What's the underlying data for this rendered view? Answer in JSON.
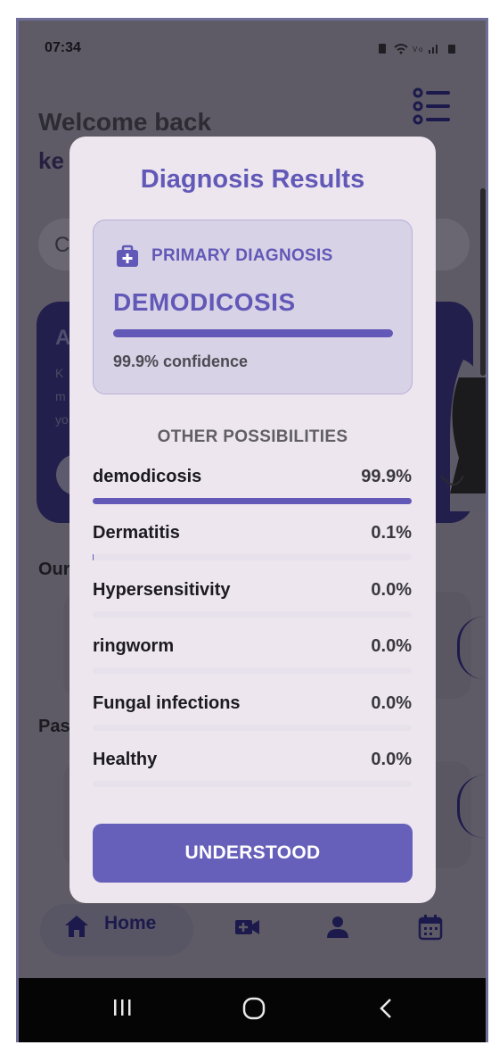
{
  "status_bar": {
    "time": "07:34",
    "icons": [
      "battery-saver-icon",
      "wifi-icon",
      "volte-icon",
      "signal-icon",
      "battery-icon"
    ]
  },
  "background": {
    "welcome_text": "Welcome back",
    "username_fragment": "ke",
    "search_fragment": "C",
    "banner_title_fragment": "A",
    "banner_text_fragment": "K\nm\nyo",
    "section_1_fragment": "Our",
    "section_2_fragment": "Pas",
    "nav_home_label": "Home"
  },
  "dialog": {
    "title": "Diagnosis Results",
    "primary": {
      "label": "PRIMARY DIAGNOSIS",
      "name": "DEMODICOSIS",
      "confidence_value": 99.9,
      "confidence_text": "99.9% confidence"
    },
    "other_heading": "OTHER POSSIBILITIES",
    "possibilities": [
      {
        "name": "demodicosis",
        "value_text": "99.9%",
        "value": 99.9
      },
      {
        "name": "Dermatitis",
        "value_text": "0.1%",
        "value": 0.1
      },
      {
        "name": "Hypersensitivity",
        "value_text": "0.0%",
        "value": 0.0
      },
      {
        "name": "ringworm",
        "value_text": "0.0%",
        "value": 0.0
      },
      {
        "name": "Fungal infections",
        "value_text": "0.0%",
        "value": 0.0
      },
      {
        "name": "Healthy",
        "value_text": "0.0%",
        "value": 0.0
      }
    ],
    "button_label": "UNDERSTOOD"
  },
  "colors": {
    "accent": "#6158b7",
    "button": "#6660bb",
    "dialog_bg": "#ede6ef",
    "card_bg": "#d8d2e6"
  }
}
